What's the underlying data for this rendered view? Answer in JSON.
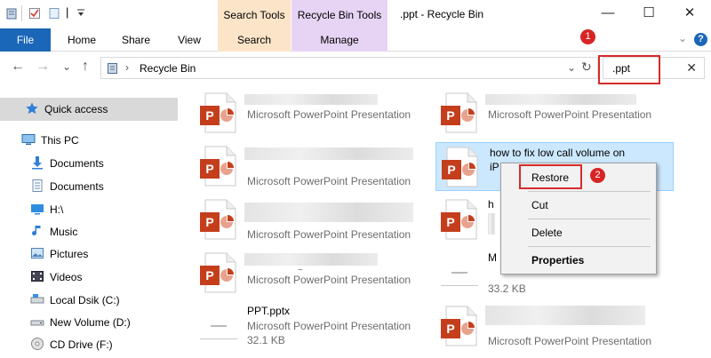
{
  "window": {
    "title": ".ppt - Recycle Bin",
    "minimize_glyph": "—",
    "maximize_glyph": "☐",
    "close_glyph": "✕"
  },
  "context_tabs": {
    "search_tools": {
      "header": "Search Tools",
      "tab": "Search",
      "color": "#fbe4c8"
    },
    "recycle_bin_tools": {
      "header": "Recycle Bin Tools",
      "tab": "Manage",
      "color": "#e7d4f5"
    }
  },
  "ribbon": {
    "file": "File",
    "tabs": [
      "Home",
      "Share",
      "View"
    ],
    "expand_glyph": "⌄",
    "help_glyph": "?",
    "accent": "#1a66b8"
  },
  "address": {
    "back_glyph": "←",
    "forward_glyph": "→",
    "recent_glyph": "⌄",
    "up_glyph": "↑",
    "sep_glyph": "›",
    "path": "Recycle Bin",
    "dropdown_glyph": "⌄",
    "refresh_glyph": "↻"
  },
  "search": {
    "value": ".ppt",
    "clear_glyph": "✕"
  },
  "badges": {
    "one": "1",
    "two": "2"
  },
  "nav": {
    "quick_access": "Quick access",
    "this_pc": "This PC",
    "items": [
      "Documents",
      "Documents",
      "H:\\",
      "Music",
      "Pictures",
      "Videos",
      "Local Dsik (C:)",
      "New Volume (D:)",
      "CD Drive (F:)"
    ]
  },
  "files": {
    "type_label": "Microsoft PowerPoint Presentation",
    "selected_name_line1": "how to fix low call volume on",
    "selected_name_prefix": "iP",
    "row3_right_prefix": "h",
    "row4_right_prefix": "M",
    "row4_right_size": "33.2 KB",
    "row4_left_suffix": "~",
    "pptx_name": "PPT.pptx",
    "pptx_size": "32.1 KB"
  },
  "context_menu": {
    "restore": "Restore",
    "cut": "Cut",
    "delete": "Delete",
    "properties": "Properties"
  }
}
